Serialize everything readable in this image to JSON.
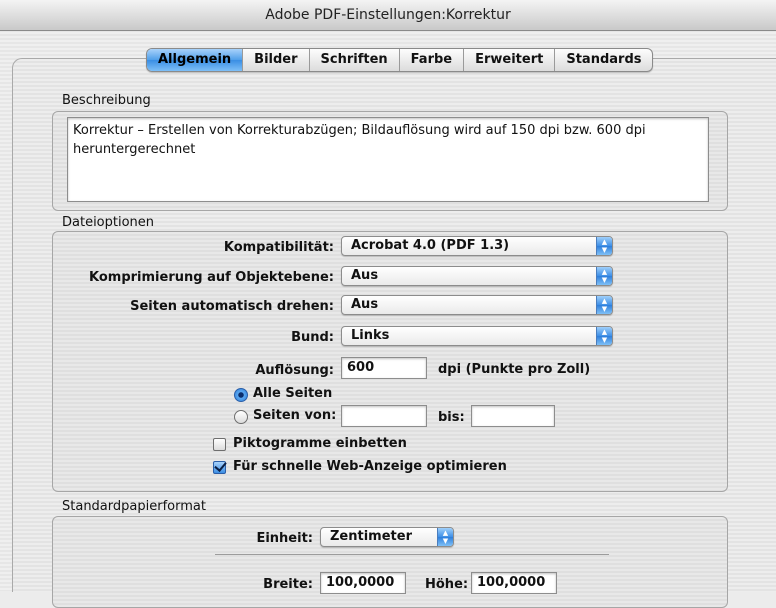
{
  "window": {
    "title": "Adobe PDF-Einstellungen:Korrektur"
  },
  "tabs": [
    "Allgemein",
    "Bilder",
    "Schriften",
    "Farbe",
    "Erweitert",
    "Standards"
  ],
  "active_tab": "Allgemein",
  "beschreibung": {
    "label": "Beschreibung",
    "text_line1": "Korrektur – Erstellen von Korrekturabzügen; Bildauflösung wird auf 150 dpi bzw. 600 dpi",
    "text_line2": "heruntergerechnet"
  },
  "dateioptionen": {
    "label": "Dateioptionen",
    "kompatibilitaet": {
      "label": "Kompatibilität:",
      "value": "Acrobat 4.0 (PDF 1.3)"
    },
    "komprimierung": {
      "label": "Komprimierung auf Objektebene:",
      "value": "Aus"
    },
    "drehen": {
      "label": "Seiten automatisch drehen:",
      "value": "Aus"
    },
    "bund": {
      "label": "Bund:",
      "value": "Links"
    },
    "aufloesung": {
      "label": "Auflösung:",
      "value": "600",
      "unit": "dpi (Punkte pro Zoll)"
    },
    "alle_seiten": {
      "label": "Alle Seiten",
      "selected": true
    },
    "seiten_von": {
      "label": "Seiten von:",
      "bis_label": "bis:",
      "from": "",
      "to": "",
      "selected": false
    },
    "piktogramme": {
      "label": "Piktogramme einbetten",
      "checked": false
    },
    "web_anzeige": {
      "label": "Für schnelle Web-Anzeige optimieren",
      "checked": true
    }
  },
  "standardpapierformat": {
    "label": "Standardpapierformat",
    "einheit": {
      "label": "Einheit:",
      "value": "Zentimeter"
    },
    "breite": {
      "label": "Breite:",
      "value": "100,0000"
    },
    "hoehe": {
      "label": "Höhe:",
      "value": "100,0000"
    }
  },
  "colors": {
    "accent": "#3a8ee4",
    "background": "#ececec"
  }
}
